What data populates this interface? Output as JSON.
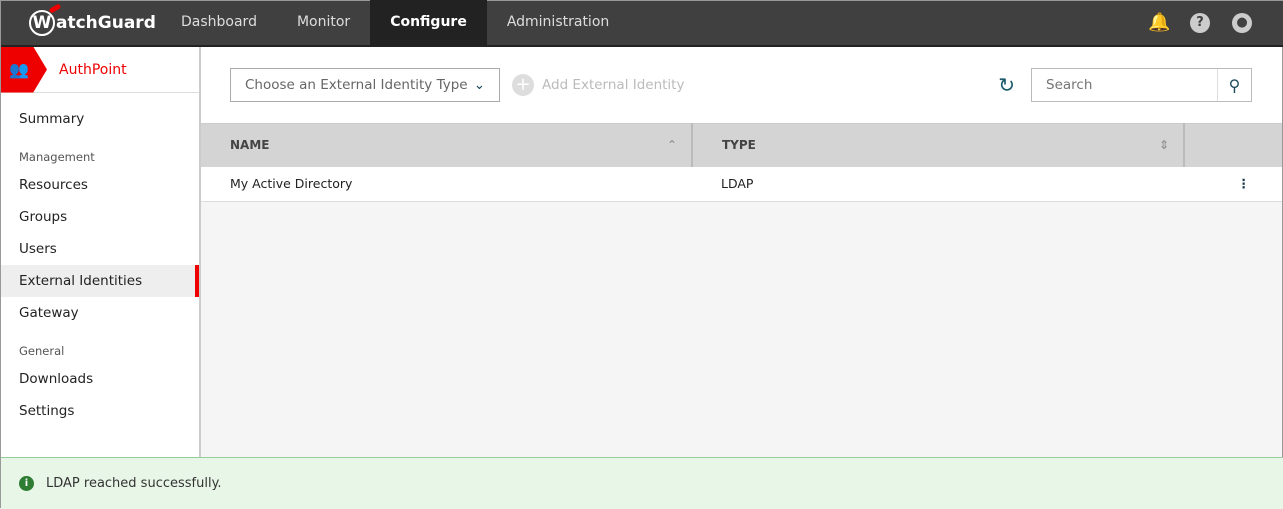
{
  "header": {
    "logo": "WatchGuard",
    "nav": [
      "Dashboard",
      "Monitor",
      "Configure",
      "Administration"
    ]
  },
  "sidebar": {
    "app": "AuthPoint",
    "summary": "Summary",
    "management_heading": "Management",
    "management": [
      "Resources",
      "Groups",
      "Users",
      "External Identities",
      "Gateway"
    ],
    "general_heading": "General",
    "general": [
      "Downloads",
      "Settings"
    ]
  },
  "toolbar": {
    "select_placeholder": "Choose an External Identity Type",
    "add_label": "Add External Identity",
    "search_placeholder": "Search"
  },
  "table": {
    "columns": [
      "NAME",
      "TYPE"
    ],
    "rows": [
      {
        "name": "My Active Directory",
        "type": "LDAP"
      }
    ]
  },
  "toast": {
    "message": "LDAP reached successfully."
  }
}
